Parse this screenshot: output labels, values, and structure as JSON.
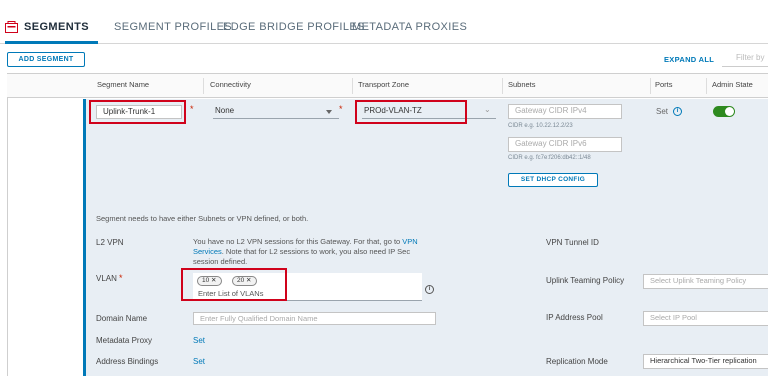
{
  "tabs": [
    "SEGMENTS",
    "SEGMENT PROFILES",
    "EDGE BRIDGE PROFILES",
    "METADATA PROXIES"
  ],
  "toolbar": {
    "add_segment": "ADD SEGMENT",
    "expand_all": "EXPAND ALL",
    "filter_placeholder": "Filter by"
  },
  "columns": [
    "Segment Name",
    "Connectivity",
    "Transport Zone",
    "Subnets",
    "Ports",
    "Admin State"
  ],
  "row": {
    "segment_name": "Uplink-Trunk-1",
    "connectivity": "None",
    "transport_zone": "PROd-VLAN-TZ",
    "gateway_ipv4_placeholder": "Gateway CIDR IPv4",
    "ipv4_hint": "CIDR e.g. 10.22.12.2/23",
    "gateway_ipv6_placeholder": "Gateway CIDR IPv6",
    "ipv6_hint": "CIDR e.g. fc7e:f206:db42::1/48",
    "dhcp_button": "SET DHCP CONFIG",
    "ports_value": "Set",
    "admin_state_on": true
  },
  "details": {
    "notice": "Segment needs to have either Subnets or VPN defined, or both.",
    "l2vpn_label": "L2 VPN",
    "l2vpn_text_1": "You have no L2 VPN sessions for this Gateway. For that, go to",
    "l2vpn_link_1": "VPN",
    "l2vpn_link_2": "Services",
    "l2vpn_text_2": ". Note that for L2 sessions to work, you also need IP Sec",
    "l2vpn_text_3": "session defined.",
    "vlan_label": "VLAN",
    "vlan_chips": [
      "10",
      "20"
    ],
    "vlan_placeholder": "Enter List of VLANs",
    "domain_label": "Domain Name",
    "domain_placeholder": "Enter Fully Qualified Domain Name",
    "metadata_label": "Metadata Proxy",
    "metadata_value": "Set",
    "address_label": "Address Bindings",
    "address_value": "Set",
    "vpn_tunnel_label": "VPN Tunnel ID",
    "uplink_teaming_label": "Uplink Teaming Policy",
    "uplink_teaming_placeholder": "Select Uplink Teaming Policy",
    "ip_pool_label": "IP Address Pool",
    "ip_pool_placeholder": "Select IP Pool",
    "replication_label": "Replication Mode",
    "replication_value": "Hierarchical Two-Tier replication"
  },
  "colors": {
    "accent": "#0079b8",
    "highlight": "#d0021b",
    "toggle_on": "#2e8a1f",
    "row_bg": "#e8eef4"
  },
  "icons": {
    "tab": "segments-icon",
    "ports_info": "info-icon",
    "vlan_info": "info-icon",
    "chip_remove": "close-icon"
  }
}
